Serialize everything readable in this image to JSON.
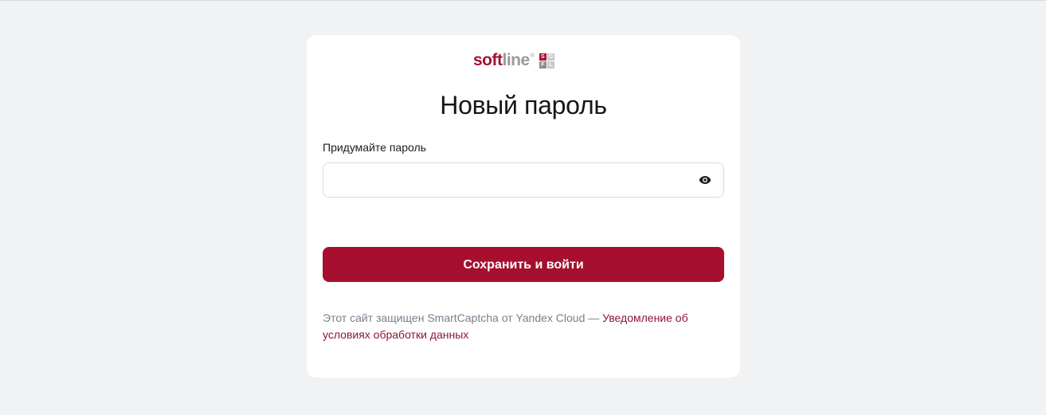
{
  "logo": {
    "soft": "soft",
    "line": "line",
    "registered": "®",
    "grid_letters": [
      "S",
      "O",
      "F",
      "L"
    ]
  },
  "page": {
    "title": "Новый пароль"
  },
  "form": {
    "password_label": "Придумайте пароль",
    "password_value": "",
    "password_placeholder": "",
    "toggle_icon": "eye-icon",
    "submit_label": "Сохранить и войти"
  },
  "footer": {
    "captcha_text": "Этот сайт защищен SmartCaptcha от Yandex Cloud — ",
    "captcha_link": "Уведомление об условиях обработки данных"
  },
  "colors": {
    "background": "#f1f2f4",
    "card": "#ffffff",
    "brand": "#a60f2d",
    "link": "#8e1537",
    "muted_text": "#7a7f8c"
  }
}
